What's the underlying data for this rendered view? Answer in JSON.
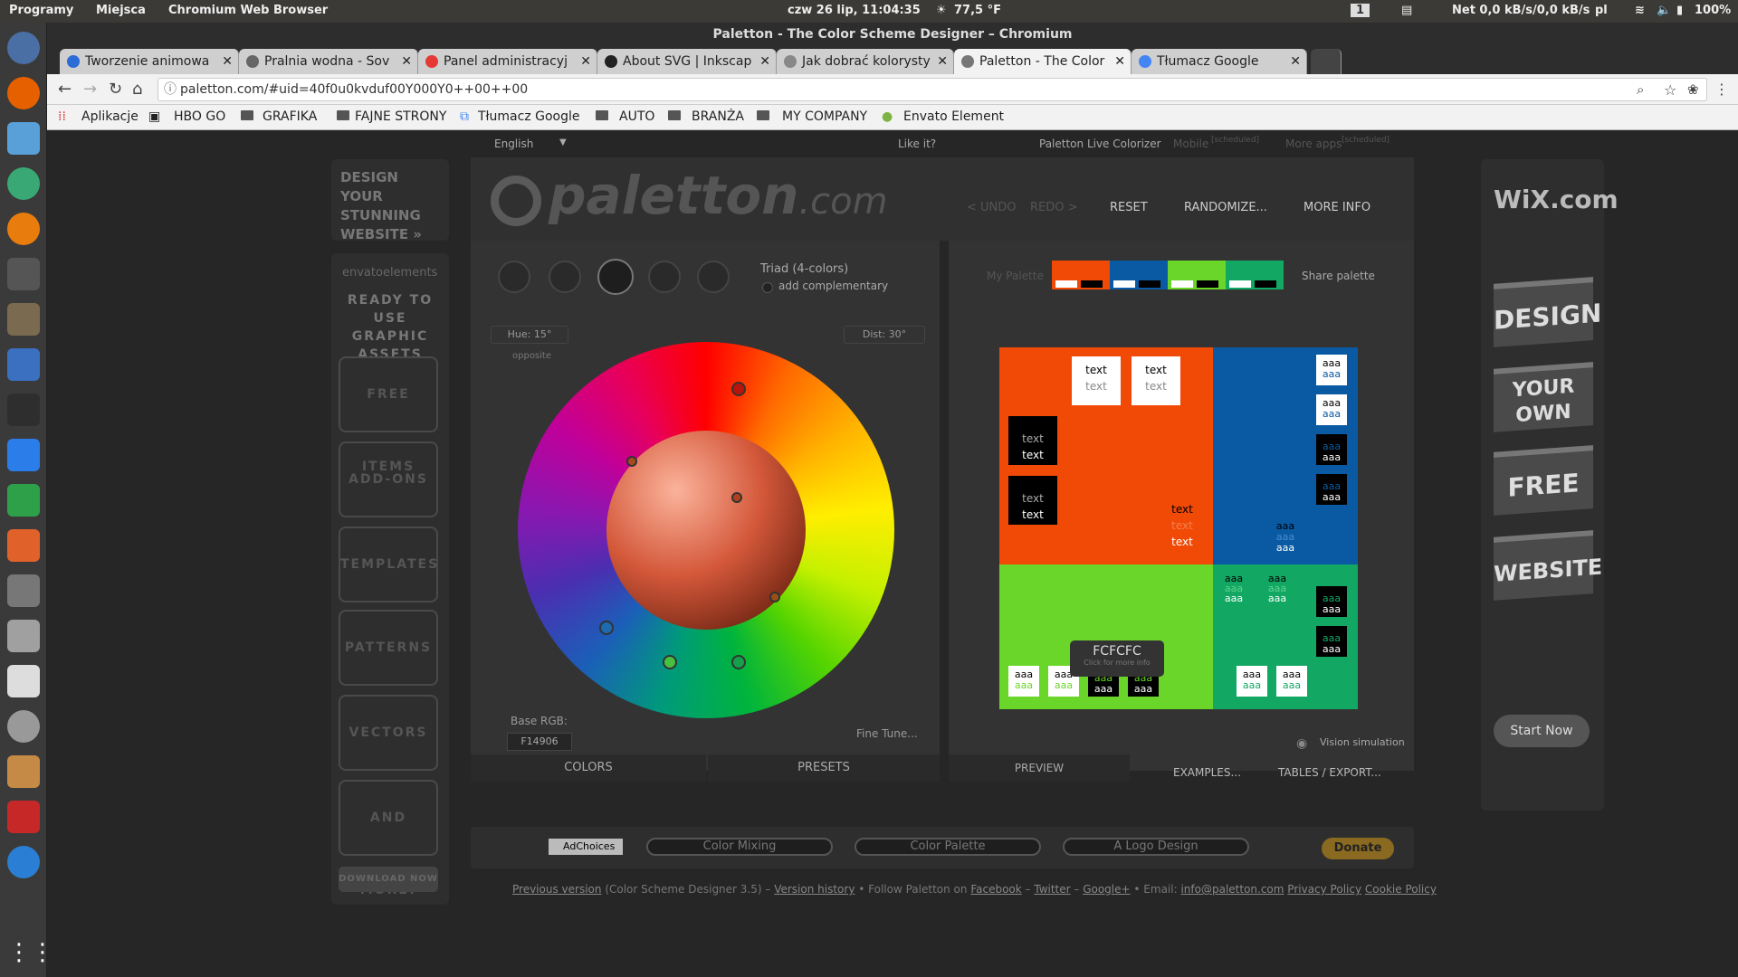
{
  "topbar": {
    "programs": "Programy",
    "places": "Miejsca",
    "app": "Chromium Web Browser",
    "datetime": "czw 26 lip, 11:04:35",
    "weather": "77,5 °F",
    "workspace": "1",
    "net": "Net 0,0 kB/s/0,0 kB/s",
    "lang": "pl",
    "battery": "100%"
  },
  "window": {
    "title": "Paletton - The Color Scheme Designer – Chromium"
  },
  "tabs": [
    {
      "label": "Tworzenie animowa",
      "color": "#2b6cd6"
    },
    {
      "label": "Pralnia wodna - Sov",
      "color": "#666"
    },
    {
      "label": "Panel administracyj",
      "color": "#e53935"
    },
    {
      "label": "About SVG | Inkscap",
      "color": "#222"
    },
    {
      "label": "Jak dobrać kolorysty",
      "color": "#888"
    },
    {
      "label": "Paletton - The Color",
      "color": "#777"
    },
    {
      "label": "Tłumacz Google",
      "color": "#4285f4"
    }
  ],
  "address": {
    "url": "paletton.com/#uid=40f0u0kvduf00Y000Y0++00++00"
  },
  "bookmarks": [
    "Aplikacje",
    "HBO GO",
    "GRAFIKA",
    "FAJNE STRONY",
    "Tłumacz Google",
    "AUTO",
    "BRANŻA",
    "MY COMPANY",
    "Envato Element"
  ],
  "site": {
    "lang": "English",
    "likeit": "Like it?",
    "live": "Paletton Live Colorizer",
    "mobile": "Mobile",
    "mobile_note": "[scheduled]",
    "more_apps": "More apps",
    "more_note": "[scheduled]",
    "logo": "paletton",
    "logo_tld": ".com",
    "undo": "< UNDO",
    "redo": "REDO >",
    "reset": "RESET",
    "randomize": "RANDOMIZE...",
    "more_info": "MORE INFO",
    "scheme": "Triad (4-colors)",
    "add_comp": "add complementary",
    "my_palette": "My Palette",
    "share": "Share palette",
    "hue": "Hue: 15°",
    "dist": "Dist: 30°",
    "opposite": "opposite",
    "base_rgb_label": "Base RGB:",
    "base_rgb": "F14906",
    "fine_tune": "Fine Tune...",
    "tab_colors": "COLORS",
    "tab_presets": "PRESETS",
    "preview": "PREVIEW",
    "examples": "EXAMPLES...",
    "tables": "TABLES / EXPORT...",
    "vision": "Vision simulation",
    "tooltip": "FCFCFC",
    "tooltip_sub": "Click for more info",
    "palette_colors": [
      "#f14906",
      "#0a5aa3",
      "#6ad62a",
      "#12a863"
    ]
  },
  "preview_text": {
    "text": "text",
    "aaa": "aaa"
  },
  "left_ad": {
    "design": "DESIGN YOUR STUNNING WEBSITE »",
    "envato": "envatoelements",
    "ready": "READY TO USE GRAPHIC ASSETS",
    "items": [
      "FREE ITEMS",
      "ADD-ONS",
      "TEMPLATES",
      "PATTERNS",
      "VECTORS",
      "AND MORE!"
    ],
    "download": "DOWNLOAD NOW"
  },
  "right_ad": {
    "wix": "WiX.com",
    "items": [
      "DESIGN",
      "YOUR OWN",
      "FREE",
      "WEBSITE"
    ],
    "start": "Start Now"
  },
  "footer": {
    "adchoices": "AdChoices",
    "links": [
      "Color Mixing",
      "Color Palette",
      "A Logo Design"
    ],
    "donate": "Donate",
    "prev": "Previous version",
    "prev_note": "(Color Scheme Designer 3.5) –",
    "history": "Version history",
    "follow": "• Follow Paletton on",
    "facebook": "Facebook",
    "twitter": "Twitter",
    "google": "Google+",
    "email": "• Email:",
    "mail": "info@paletton.com",
    "privacy": "Privacy Policy",
    "cookie": "Cookie Policy"
  }
}
